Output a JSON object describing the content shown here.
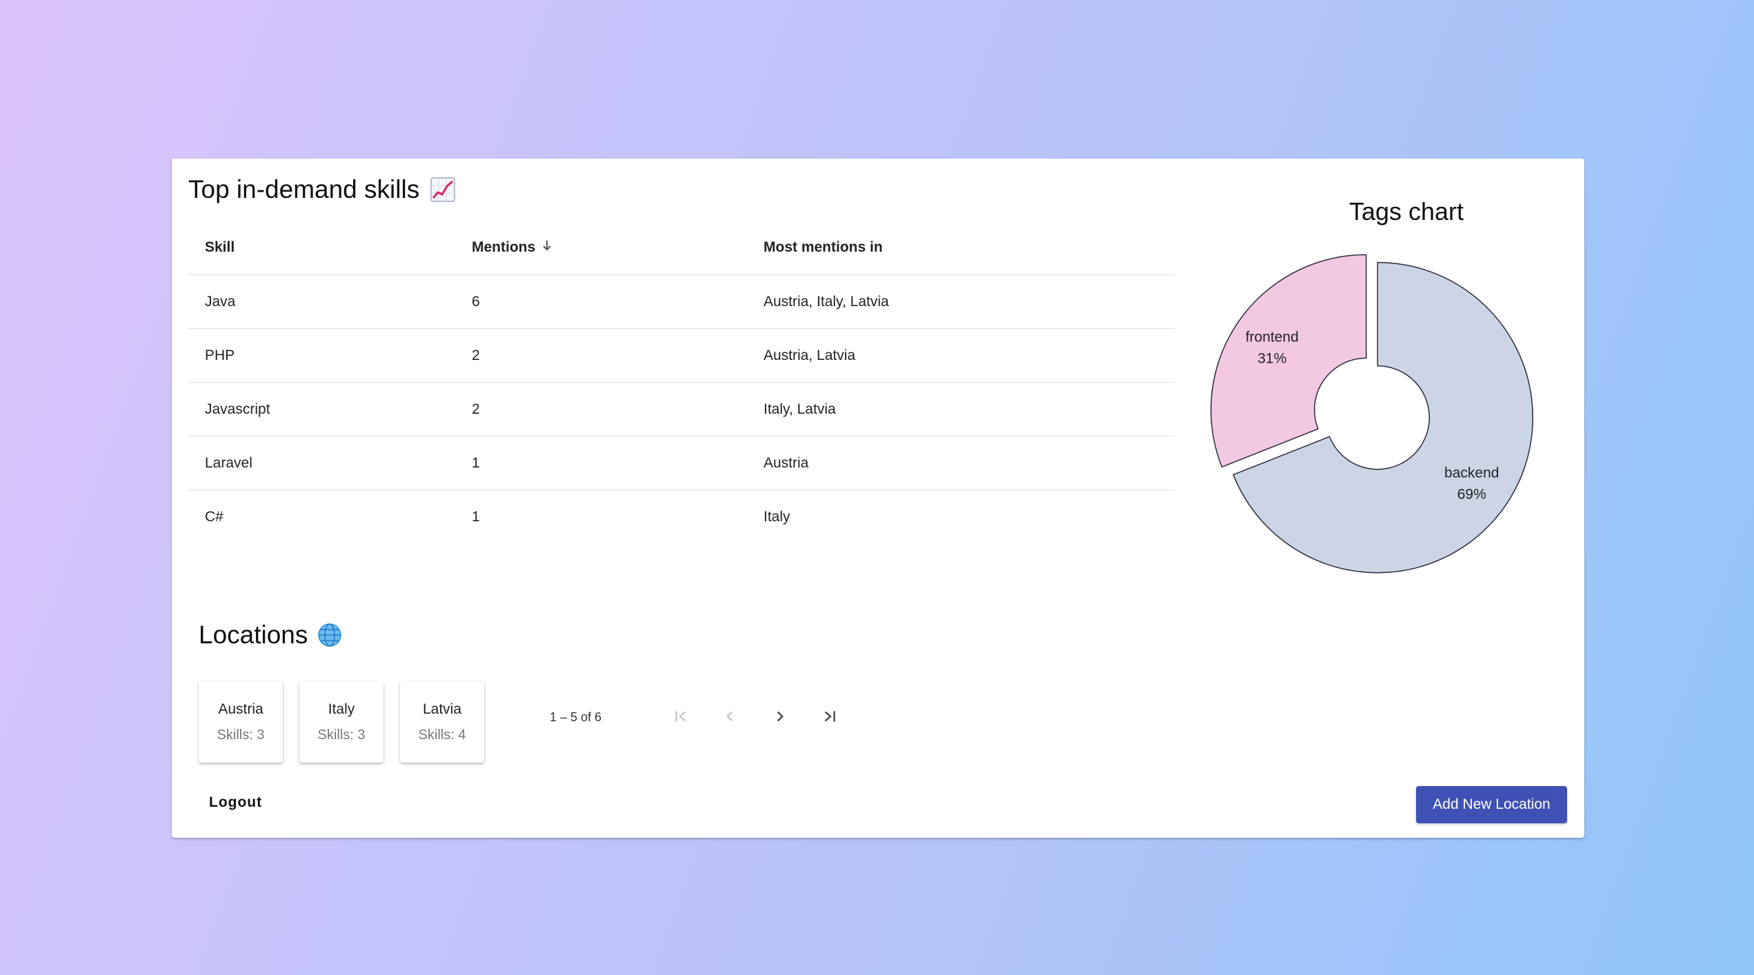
{
  "skills_section": {
    "title": "Top in-demand skills",
    "title_icon": "chart-increasing-icon",
    "columns": {
      "skill": "Skill",
      "mentions": "Mentions",
      "most_mentions_in": "Most mentions in"
    },
    "rows": [
      {
        "skill": "Java",
        "mentions": "6",
        "most_mentions_in": "Austria, Italy, Latvia"
      },
      {
        "skill": "PHP",
        "mentions": "2",
        "most_mentions_in": "Austria, Latvia"
      },
      {
        "skill": "Javascript",
        "mentions": "2",
        "most_mentions_in": "Italy, Latvia"
      },
      {
        "skill": "Laravel",
        "mentions": "1",
        "most_mentions_in": "Austria"
      },
      {
        "skill": "C#",
        "mentions": "1",
        "most_mentions_in": "Italy"
      }
    ],
    "paginator": {
      "range_label": "1 – 5 of 6"
    }
  },
  "locations_section": {
    "title": "Locations",
    "title_icon": "globe-icon",
    "cards": [
      {
        "name": "Austria",
        "skills": "Skills: 3"
      },
      {
        "name": "Italy",
        "skills": "Skills: 3"
      },
      {
        "name": "Latvia",
        "skills": "Skills: 4"
      }
    ]
  },
  "actions": {
    "logout_label": "Logout",
    "add_location_label": "Add New Location",
    "accent_color": "#3f51b5"
  },
  "chart_data": {
    "type": "pie",
    "title": "Tags chart",
    "donut": true,
    "slices": [
      {
        "name": "backend",
        "value": 69,
        "label": "69%",
        "color": "#cbd5e6"
      },
      {
        "name": "frontend",
        "value": 31,
        "label": "31%",
        "color": "#f3c8e3"
      }
    ]
  }
}
